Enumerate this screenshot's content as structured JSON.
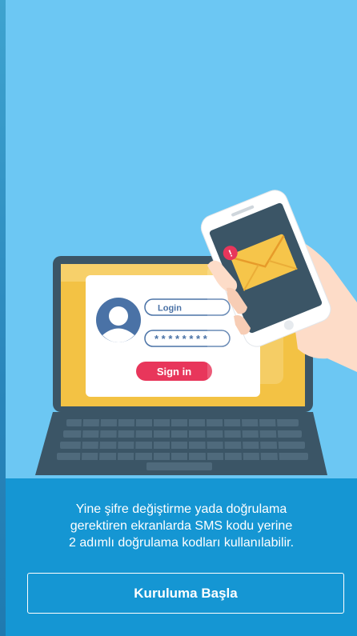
{
  "illustration": {
    "login_label": "Login",
    "password_mask": "* * * * * * * *",
    "signin_label": "Sign in",
    "alert_mark": "!"
  },
  "onboarding": {
    "message_lines": [
      "Yine şifre değiştirme yada doğrulama",
      "gerektiren ekranlarda SMS kodu yerine",
      "2 adımlı doğrulama kodları kullanılabilir."
    ],
    "cta_label": "Kuruluma Başla"
  },
  "colors": {
    "background": "#6cc7f3",
    "bottom_panel": "#1596d3",
    "laptop_body": "#3b5566",
    "accent": "#e8365b"
  }
}
